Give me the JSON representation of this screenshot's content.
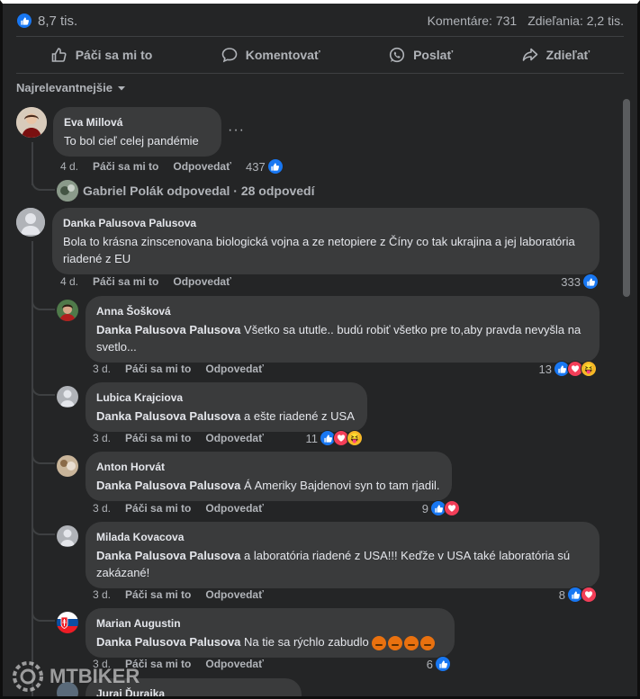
{
  "stats": {
    "likes": "8,7 tis.",
    "comments": "Komentáre: 731",
    "shares": "Zdieľania: 2,2 tis."
  },
  "actions": {
    "like": "Páči sa mi to",
    "comment": "Komentovať",
    "send": "Poslať",
    "share": "Zdieľať"
  },
  "sort_label": "Najrelevantnejšie",
  "comments": [
    {
      "name": "Eva Millová",
      "text": "To bol cieľ celej pandémie",
      "time": "4 d.",
      "like": "Páči sa mi to",
      "reply": "Odpovedať",
      "reactions": "437"
    },
    {
      "replies_summary": "Gabriel Polák odpovedal · 28 odpovedí"
    },
    {
      "name": "Danka Palusova Palusova",
      "text": "Bola to krásna zinscenovana biologická vojna a ze netopiere z Číny co tak ukrajina a jej laboratória riadené z EU",
      "time": "4 d.",
      "like": "Páči sa mi to",
      "reply": "Odpovedať",
      "reactions": "333"
    }
  ],
  "replies": [
    {
      "name": "Anna Šošková",
      "mention": "Danka Palusova Palusova",
      "text": " Všetko sa ututle.. budú robiť všetko pre to,aby pravda nevyšla na svetlo...",
      "time": "3 d.",
      "like": "Páči sa mi to",
      "reply": "Odpovedať",
      "reactions": "13"
    },
    {
      "name": "Lubica Krajciova",
      "mention": "Danka Palusova Palusova",
      "text": " a ešte riadené z USA",
      "time": "3 d.",
      "like": "Páči sa mi to",
      "reply": "Odpovedať",
      "reactions": "11"
    },
    {
      "name": "Anton Horvát",
      "mention": "Danka Palusova Palusova",
      "text": " Á Ameriky Bajdenovi syn to tam rjadil.",
      "time": "3 d.",
      "like": "Páči sa mi to",
      "reply": "Odpovedať",
      "reactions": "9"
    },
    {
      "name": "Milada Kovacova",
      "mention": "Danka Palusova Palusova",
      "text": " a laboratória riadené z USA!!! Keďže v USA také laboratória sú zakázané!",
      "time": "3 d.",
      "like": "Páči sa mi to",
      "reply": "Odpovedať",
      "reactions": "8"
    },
    {
      "name": "Marian Augustin",
      "mention": "Danka Palusova Palusova",
      "text": " Na tie sa rýchlo zabudlo ",
      "time": "3 d.",
      "like": "Páči sa mi to",
      "reply": "Odpovedať",
      "reactions": "6"
    },
    {
      "name": "Juraj Ďuraika"
    }
  ],
  "watermark": "MTBIKER",
  "colors": {
    "like": "#1877f2",
    "love": "#f33e58",
    "haha": "#f7b928",
    "bubble": "#3a3b3c",
    "background": "#242526"
  }
}
